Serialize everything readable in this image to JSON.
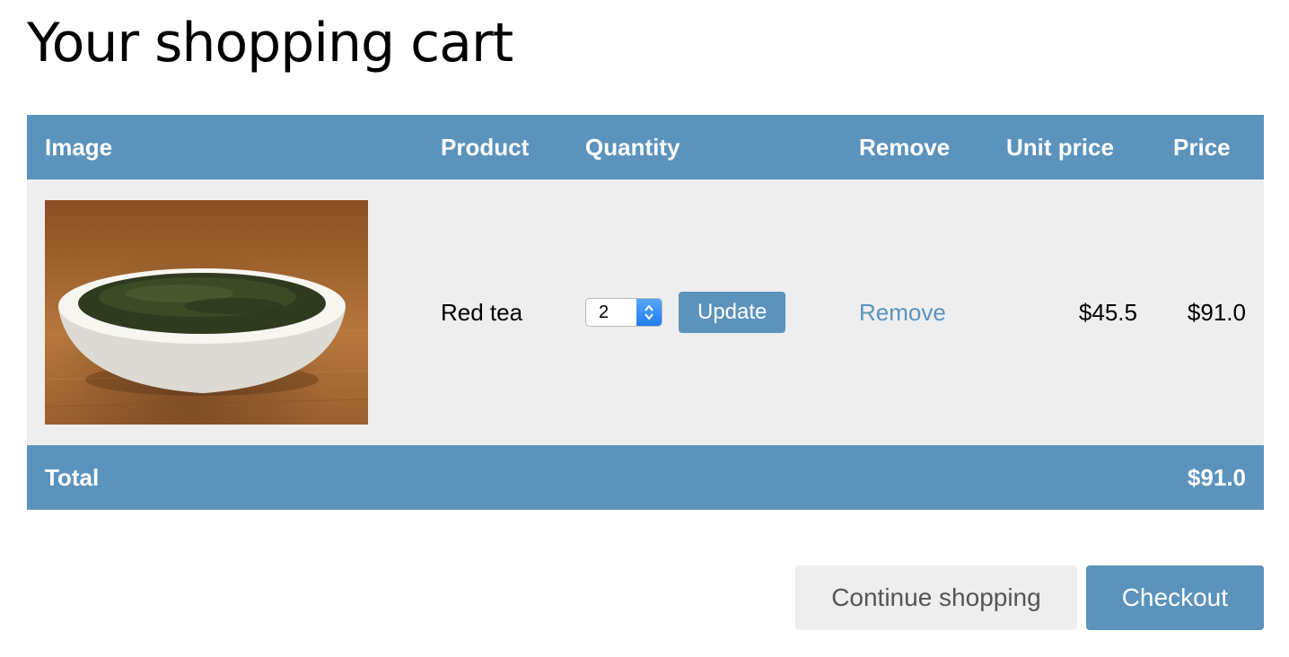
{
  "page": {
    "title": "Your shopping cart"
  },
  "table": {
    "headers": {
      "image": "Image",
      "product": "Product",
      "quantity": "Quantity",
      "remove": "Remove",
      "unit_price": "Unit price",
      "price": "Price"
    },
    "items": [
      {
        "product": "Red tea",
        "quantity": "2",
        "update_label": "Update",
        "remove_label": "Remove",
        "unit_price": "$45.5",
        "price": "$91.0"
      }
    ],
    "total": {
      "label": "Total",
      "value": "$91.0"
    }
  },
  "actions": {
    "continue_label": "Continue shopping",
    "checkout_label": "Checkout"
  },
  "colors": {
    "accent": "#5b93bd",
    "row_background": "#eeeeee",
    "stepper_blue": "#1f7cf2"
  },
  "icons": {
    "stepper": "up-down-chevron-icon"
  }
}
